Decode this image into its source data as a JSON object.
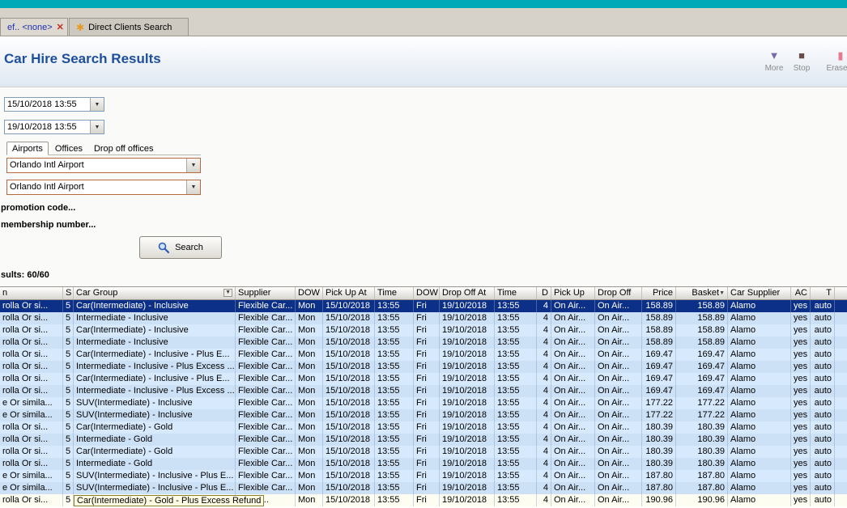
{
  "colors": {
    "titlebar": "#00a9b8",
    "selected_row": "#0c2f87",
    "title_text": "#1d4f9c",
    "row_blue": "#d7e9fc"
  },
  "icons": {
    "close": "✕",
    "clients": "✱",
    "dropdown": "▼",
    "sort": "▼",
    "filter": "▼",
    "more": "▼",
    "stop": "■",
    "eraser": "▮"
  },
  "tabs": [
    {
      "label": "ef.. <none>",
      "active": true
    },
    {
      "label": "Direct Clients Search",
      "active": false
    }
  ],
  "header": {
    "title": "Car Hire Search Results",
    "toolbar": [
      {
        "label": "More"
      },
      {
        "label": "Stop"
      },
      {
        "label": "Erase F"
      }
    ]
  },
  "form": {
    "pickup_datetime": "15/10/2018 13:55",
    "dropoff_datetime": "19/10/2018 13:55",
    "location_tabs": [
      "Airports",
      "Offices",
      "Drop off offices"
    ],
    "pickup_location": "Orlando Intl Airport",
    "dropoff_location": "Orlando Intl Airport",
    "promotion_label": "promotion code...",
    "membership_label": "membership number...",
    "search_label": "Search"
  },
  "results": {
    "count_label": "sults: 60/60",
    "columns": [
      "n",
      "S",
      "Car Group",
      "Supplier",
      "DOW",
      "Pick Up At",
      "Time",
      "DOW",
      "Drop Off At",
      "Time",
      "D",
      "Pick Up",
      "Drop Off",
      "Price",
      "Basket",
      "Car Supplier",
      "AC",
      "T"
    ],
    "rows": [
      {
        "model": "rolla Or si...",
        "s": "5",
        "car_group": "Car(Intermediate) - Inclusive",
        "supplier": "Flexible Car...",
        "dow1": "Mon",
        "pickup_at": "15/10/2018",
        "time1": "13:55",
        "dow2": "Fri",
        "dropoff_at": "19/10/2018",
        "time2": "13:55",
        "d": "4",
        "pickup": "On Air...",
        "dropoff": "On Air...",
        "price": "158.89",
        "basket": "158.89",
        "car_supplier": "Alamo",
        "ac": "yes",
        "t": "auto",
        "selected": true
      },
      {
        "model": "rolla Or si...",
        "s": "5",
        "car_group": "Intermediate - Inclusive",
        "supplier": "Flexible Car...",
        "dow1": "Mon",
        "pickup_at": "15/10/2018",
        "time1": "13:55",
        "dow2": "Fri",
        "dropoff_at": "19/10/2018",
        "time2": "13:55",
        "d": "4",
        "pickup": "On Air...",
        "dropoff": "On Air...",
        "price": "158.89",
        "basket": "158.89",
        "car_supplier": "Alamo",
        "ac": "yes",
        "t": "auto"
      },
      {
        "model": "rolla Or si...",
        "s": "5",
        "car_group": "Car(Intermediate) - Inclusive",
        "supplier": "Flexible Car...",
        "dow1": "Mon",
        "pickup_at": "15/10/2018",
        "time1": "13:55",
        "dow2": "Fri",
        "dropoff_at": "19/10/2018",
        "time2": "13:55",
        "d": "4",
        "pickup": "On Air...",
        "dropoff": "On Air...",
        "price": "158.89",
        "basket": "158.89",
        "car_supplier": "Alamo",
        "ac": "yes",
        "t": "auto"
      },
      {
        "model": "rolla Or si...",
        "s": "5",
        "car_group": "Intermediate - Inclusive",
        "supplier": "Flexible Car...",
        "dow1": "Mon",
        "pickup_at": "15/10/2018",
        "time1": "13:55",
        "dow2": "Fri",
        "dropoff_at": "19/10/2018",
        "time2": "13:55",
        "d": "4",
        "pickup": "On Air...",
        "dropoff": "On Air...",
        "price": "158.89",
        "basket": "158.89",
        "car_supplier": "Alamo",
        "ac": "yes",
        "t": "auto"
      },
      {
        "model": "rolla Or si...",
        "s": "5",
        "car_group": "Car(Intermediate) - Inclusive - Plus E...",
        "supplier": "Flexible Car...",
        "dow1": "Mon",
        "pickup_at": "15/10/2018",
        "time1": "13:55",
        "dow2": "Fri",
        "dropoff_at": "19/10/2018",
        "time2": "13:55",
        "d": "4",
        "pickup": "On Air...",
        "dropoff": "On Air...",
        "price": "169.47",
        "basket": "169.47",
        "car_supplier": "Alamo",
        "ac": "yes",
        "t": "auto"
      },
      {
        "model": "rolla Or si...",
        "s": "5",
        "car_group": "Intermediate - Inclusive - Plus Excess ...",
        "supplier": "Flexible Car...",
        "dow1": "Mon",
        "pickup_at": "15/10/2018",
        "time1": "13:55",
        "dow2": "Fri",
        "dropoff_at": "19/10/2018",
        "time2": "13:55",
        "d": "4",
        "pickup": "On Air...",
        "dropoff": "On Air...",
        "price": "169.47",
        "basket": "169.47",
        "car_supplier": "Alamo",
        "ac": "yes",
        "t": "auto"
      },
      {
        "model": "rolla Or si...",
        "s": "5",
        "car_group": "Car(Intermediate) - Inclusive - Plus E...",
        "supplier": "Flexible Car...",
        "dow1": "Mon",
        "pickup_at": "15/10/2018",
        "time1": "13:55",
        "dow2": "Fri",
        "dropoff_at": "19/10/2018",
        "time2": "13:55",
        "d": "4",
        "pickup": "On Air...",
        "dropoff": "On Air...",
        "price": "169.47",
        "basket": "169.47",
        "car_supplier": "Alamo",
        "ac": "yes",
        "t": "auto"
      },
      {
        "model": "rolla Or si...",
        "s": "5",
        "car_group": "Intermediate - Inclusive - Plus Excess ...",
        "supplier": "Flexible Car...",
        "dow1": "Mon",
        "pickup_at": "15/10/2018",
        "time1": "13:55",
        "dow2": "Fri",
        "dropoff_at": "19/10/2018",
        "time2": "13:55",
        "d": "4",
        "pickup": "On Air...",
        "dropoff": "On Air...",
        "price": "169.47",
        "basket": "169.47",
        "car_supplier": "Alamo",
        "ac": "yes",
        "t": "auto"
      },
      {
        "model": "e Or simila...",
        "s": "5",
        "car_group": "SUV(Intermediate) - Inclusive",
        "supplier": "Flexible Car...",
        "dow1": "Mon",
        "pickup_at": "15/10/2018",
        "time1": "13:55",
        "dow2": "Fri",
        "dropoff_at": "19/10/2018",
        "time2": "13:55",
        "d": "4",
        "pickup": "On Air...",
        "dropoff": "On Air...",
        "price": "177.22",
        "basket": "177.22",
        "car_supplier": "Alamo",
        "ac": "yes",
        "t": "auto"
      },
      {
        "model": "e Or simila...",
        "s": "5",
        "car_group": "SUV(Intermediate) - Inclusive",
        "supplier": "Flexible Car...",
        "dow1": "Mon",
        "pickup_at": "15/10/2018",
        "time1": "13:55",
        "dow2": "Fri",
        "dropoff_at": "19/10/2018",
        "time2": "13:55",
        "d": "4",
        "pickup": "On Air...",
        "dropoff": "On Air...",
        "price": "177.22",
        "basket": "177.22",
        "car_supplier": "Alamo",
        "ac": "yes",
        "t": "auto"
      },
      {
        "model": "rolla Or si...",
        "s": "5",
        "car_group": "Car(Intermediate) - Gold",
        "supplier": "Flexible Car...",
        "dow1": "Mon",
        "pickup_at": "15/10/2018",
        "time1": "13:55",
        "dow2": "Fri",
        "dropoff_at": "19/10/2018",
        "time2": "13:55",
        "d": "4",
        "pickup": "On Air...",
        "dropoff": "On Air...",
        "price": "180.39",
        "basket": "180.39",
        "car_supplier": "Alamo",
        "ac": "yes",
        "t": "auto"
      },
      {
        "model": "rolla Or si...",
        "s": "5",
        "car_group": "Intermediate - Gold",
        "supplier": "Flexible Car...",
        "dow1": "Mon",
        "pickup_at": "15/10/2018",
        "time1": "13:55",
        "dow2": "Fri",
        "dropoff_at": "19/10/2018",
        "time2": "13:55",
        "d": "4",
        "pickup": "On Air...",
        "dropoff": "On Air...",
        "price": "180.39",
        "basket": "180.39",
        "car_supplier": "Alamo",
        "ac": "yes",
        "t": "auto"
      },
      {
        "model": "rolla Or si...",
        "s": "5",
        "car_group": "Car(Intermediate) - Gold",
        "supplier": "Flexible Car...",
        "dow1": "Mon",
        "pickup_at": "15/10/2018",
        "time1": "13:55",
        "dow2": "Fri",
        "dropoff_at": "19/10/2018",
        "time2": "13:55",
        "d": "4",
        "pickup": "On Air...",
        "dropoff": "On Air...",
        "price": "180.39",
        "basket": "180.39",
        "car_supplier": "Alamo",
        "ac": "yes",
        "t": "auto"
      },
      {
        "model": "rolla Or si...",
        "s": "5",
        "car_group": "Intermediate - Gold",
        "supplier": "Flexible Car...",
        "dow1": "Mon",
        "pickup_at": "15/10/2018",
        "time1": "13:55",
        "dow2": "Fri",
        "dropoff_at": "19/10/2018",
        "time2": "13:55",
        "d": "4",
        "pickup": "On Air...",
        "dropoff": "On Air...",
        "price": "180.39",
        "basket": "180.39",
        "car_supplier": "Alamo",
        "ac": "yes",
        "t": "auto"
      },
      {
        "model": "e Or simila...",
        "s": "5",
        "car_group": "SUV(Intermediate) - Inclusive - Plus E...",
        "supplier": "Flexible Car...",
        "dow1": "Mon",
        "pickup_at": "15/10/2018",
        "time1": "13:55",
        "dow2": "Fri",
        "dropoff_at": "19/10/2018",
        "time2": "13:55",
        "d": "4",
        "pickup": "On Air...",
        "dropoff": "On Air...",
        "price": "187.80",
        "basket": "187.80",
        "car_supplier": "Alamo",
        "ac": "yes",
        "t": "auto"
      },
      {
        "model": "e Or simila...",
        "s": "5",
        "car_group": "SUV(Intermediate) - Inclusive - Plus E...",
        "supplier": "Flexible Car...",
        "dow1": "Mon",
        "pickup_at": "15/10/2018",
        "time1": "13:55",
        "dow2": "Fri",
        "dropoff_at": "19/10/2018",
        "time2": "13:55",
        "d": "4",
        "pickup": "On Air...",
        "dropoff": "On Air...",
        "price": "187.80",
        "basket": "187.80",
        "car_supplier": "Alamo",
        "ac": "yes",
        "t": "auto"
      },
      {
        "model": "rolla Or si...",
        "s": "5",
        "car_group": "Car(Intermediate) - Gold - Plus Excess Refund",
        "supplier": "le Car...",
        "dow1": "Mon",
        "pickup_at": "15/10/2018",
        "time1": "13:55",
        "dow2": "Fri",
        "dropoff_at": "19/10/2018",
        "time2": "13:55",
        "d": "4",
        "pickup": "On Air...",
        "dropoff": "On Air...",
        "price": "190.96",
        "basket": "190.96",
        "car_supplier": "Alamo",
        "ac": "yes",
        "t": "auto",
        "edit": true,
        "focus_cell": "car_group"
      }
    ]
  }
}
